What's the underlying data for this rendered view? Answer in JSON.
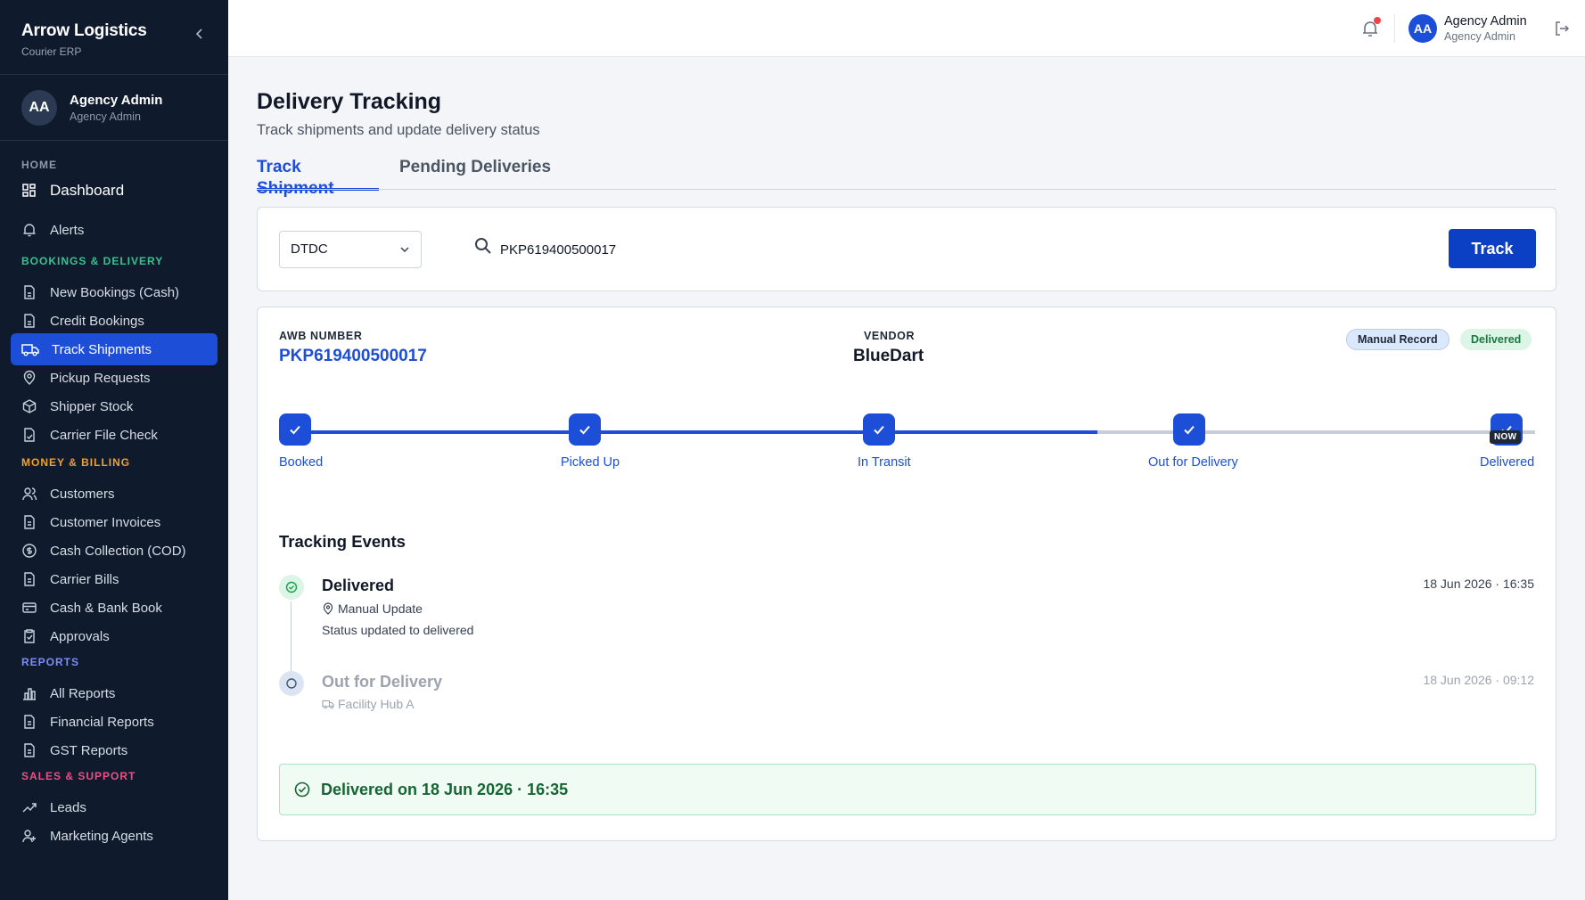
{
  "brand": {
    "title": "Arrow Logistics",
    "subtitle": "Courier ERP"
  },
  "user": {
    "initials": "AA",
    "name": "Agency Admin",
    "role": "Agency Admin"
  },
  "nav": {
    "home_label": "HOME",
    "dashboard": "Dashboard",
    "alerts": "Alerts",
    "bookings_label": "BOOKINGS & DELIVERY",
    "new_bookings": "New Bookings (Cash)",
    "credit_bookings": "Credit Bookings",
    "track_shipments": "Track Shipments",
    "pickup_requests": "Pickup Requests",
    "shipper_stock": "Shipper Stock",
    "carrier_file_check": "Carrier File Check",
    "money_label": "MONEY & BILLING",
    "customers": "Customers",
    "customer_invoices": "Customer Invoices",
    "cash_collection": "Cash Collection (COD)",
    "carrier_bills": "Carrier Bills",
    "cash_bank_book": "Cash & Bank Book",
    "approvals": "Approvals",
    "reports_label": "REPORTS",
    "all_reports": "All Reports",
    "financial_reports": "Financial Reports",
    "gst_reports": "GST Reports",
    "sales_label": "SALES & SUPPORT",
    "leads": "Leads",
    "marketing_agents": "Marketing Agents"
  },
  "topbar": {
    "initials": "AA",
    "name": "Agency Admin",
    "role": "Agency Admin"
  },
  "page": {
    "title": "Delivery Tracking",
    "subtitle": "Track shipments and update delivery status"
  },
  "tabs": {
    "track": "Track Shipment",
    "pending": "Pending Deliveries"
  },
  "search": {
    "carrier": "DTDC",
    "awb_value": "PKP619400500017",
    "button": "Track"
  },
  "result": {
    "awb_label": "AWB NUMBER",
    "awb_value": "PKP619400500017",
    "vendor_label": "VENDOR",
    "vendor_value": "BlueDart",
    "badge_manual": "Manual Record",
    "badge_status": "Delivered",
    "steps": [
      "Booked",
      "Picked Up",
      "In Transit",
      "Out for Delivery",
      "Delivered"
    ],
    "now_tag": "NOW"
  },
  "events": {
    "title": "Tracking Events",
    "list": [
      {
        "status": "Delivered",
        "location": "Manual Update",
        "description": "Status updated to delivered",
        "time": "18 Jun 2026 · 16:35"
      },
      {
        "status": "Out for Delivery",
        "location": "Facility Hub A",
        "time": "18 Jun 2026 · 09:12"
      }
    ]
  },
  "delivered_banner": "Delivered on 18 Jun 2026 · 16:35",
  "colors": {
    "primary": "#1d4ed8",
    "sidebar": "#0f1b2d",
    "success": "#166534"
  }
}
